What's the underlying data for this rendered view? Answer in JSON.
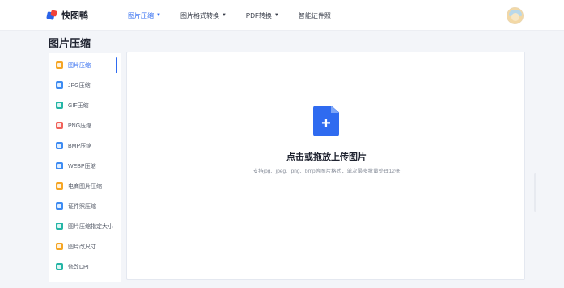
{
  "app": {
    "logo_text": "快图鸭"
  },
  "nav": [
    {
      "label": "图片压缩",
      "active": true,
      "has_dropdown": true
    },
    {
      "label": "图片格式转换",
      "active": false,
      "has_dropdown": true
    },
    {
      "label": "PDF转换",
      "active": false,
      "has_dropdown": true
    },
    {
      "label": "智能证件照",
      "active": false,
      "has_dropdown": false
    }
  ],
  "page": {
    "title": "图片压缩"
  },
  "sidebar": {
    "items": [
      {
        "label": "图片压缩",
        "active": true,
        "icon": "image-compress-icon",
        "color": "#f5a524"
      },
      {
        "label": "JPG压缩",
        "active": false,
        "icon": "jpg-icon",
        "color": "#3d8bf2"
      },
      {
        "label": "GIF压缩",
        "active": false,
        "icon": "gif-icon",
        "color": "#24b5a6"
      },
      {
        "label": "PNG压缩",
        "active": false,
        "icon": "png-icon",
        "color": "#f0625a"
      },
      {
        "label": "BMP压缩",
        "active": false,
        "icon": "bmp-icon",
        "color": "#3d8bf2"
      },
      {
        "label": "WEBP压缩",
        "active": false,
        "icon": "webp-icon",
        "color": "#3d8bf2"
      },
      {
        "label": "电商图片压缩",
        "active": false,
        "icon": "ecommerce-icon",
        "color": "#f5a524"
      },
      {
        "label": "证件照压缩",
        "active": false,
        "icon": "id-photo-icon",
        "color": "#3d8bf2"
      },
      {
        "label": "图片压缩指定大小",
        "active": false,
        "icon": "target-size-icon",
        "color": "#24b5a6"
      },
      {
        "label": "图片改尺寸",
        "active": false,
        "icon": "resize-icon",
        "color": "#f5a524"
      },
      {
        "label": "修改DPI",
        "active": false,
        "icon": "dpi-icon",
        "color": "#24b5a6"
      }
    ]
  },
  "upload": {
    "icon": "upload-file-icon",
    "title": "点击或拖放上传图片",
    "hint": "支持jpg、jpeg、png、bmp等图片格式，单次最多批量处理12张"
  },
  "colors": {
    "accent": "#2f6bf0",
    "background": "#f3f5f9"
  }
}
